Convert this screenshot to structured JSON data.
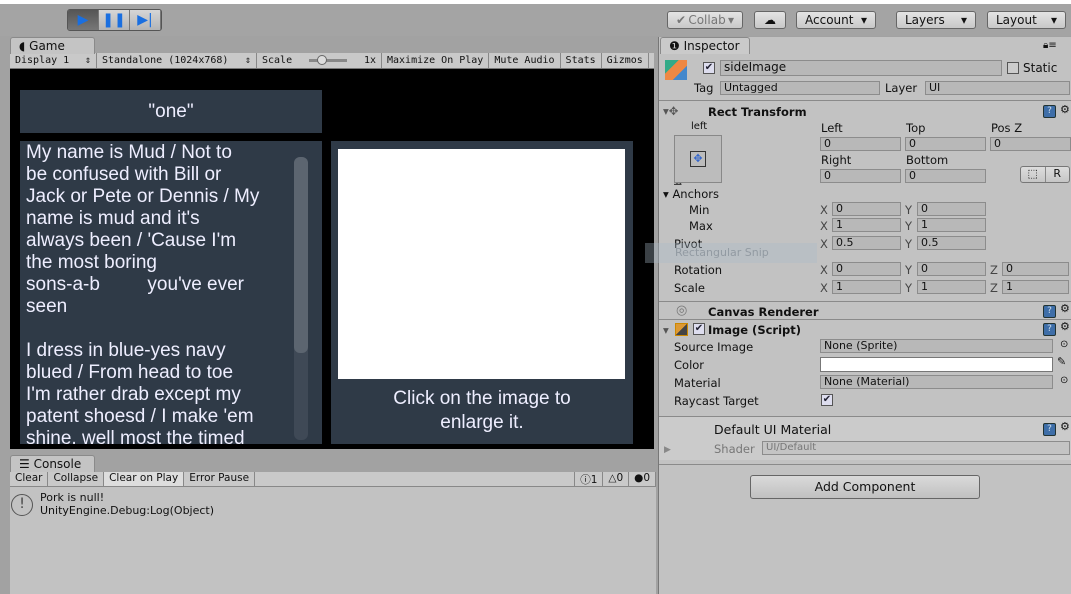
{
  "toolbar": {
    "play_icon": "play-icon",
    "pause_icon": "pause-icon",
    "step_icon": "step-icon",
    "collab": "Collab",
    "account": "Account",
    "layers": "Layers",
    "layout": "Layout"
  },
  "game": {
    "tab": "Game",
    "display": "Display 1",
    "resolution": "Standalone (1024x768)",
    "scale_label": "Scale",
    "scale_value": "1x",
    "maximize": "Maximize On Play",
    "mute": "Mute Audio",
    "stats": "Stats",
    "gizmos": "Gizmos",
    "header": "\"one\"",
    "poem_lines": [
      "My name is Mud / Not to",
      "be confused with Bill or",
      "Jack or Pete or Dennis / My",
      "name is mud and it's",
      "always been / 'Cause I'm",
      "the most boring",
      "sons-a-b         you've ever",
      "seen",
      "",
      "I dress in blue-yes navy",
      "blued / From head to toe",
      "I'm rather drab except my",
      "patent shoesd / I make 'em",
      "shine, well most the timed"
    ],
    "caption": "Click on the image to enlarge it.",
    "image_color": "#ffffff",
    "panel_color": "#2f3a47"
  },
  "console": {
    "tab": "Console",
    "clear": "Clear",
    "collapse": "Collapse",
    "clear_on_play": "Clear on Play",
    "error_pause": "Error Pause",
    "info_count": "1",
    "warn_count": "0",
    "error_count": "0",
    "message_line1": "Pork is null!",
    "message_line2": "UnityEngine.Debug:Log(Object)"
  },
  "inspector": {
    "tab": "Inspector",
    "object_name": "sideImage",
    "static": "Static",
    "tag_label": "Tag",
    "tag": "Untagged",
    "layer_label": "Layer",
    "layer": "UI",
    "rect_transform": "Rect Transform",
    "anchor_preset_top": "left",
    "anchor_preset_side": "bottom",
    "left_label": "Left",
    "left": "0",
    "top_label": "Top",
    "top": "0",
    "posz_label": "Pos Z",
    "posz": "0",
    "right_label": "Right",
    "right": "0",
    "bottom_label": "Bottom",
    "bottom": "0",
    "r_button": "R",
    "anchors": "Anchors",
    "min": "Min",
    "max": "Max",
    "pivot": "Pivot",
    "rotation": "Rotation",
    "scale": "Scale",
    "x": "X",
    "y": "Y",
    "z": "Z",
    "min_x": "0",
    "min_y": "0",
    "max_x": "1",
    "max_y": "1",
    "pivot_x": "0.5",
    "pivot_y": "0.5",
    "rot_x": "0",
    "rot_y": "0",
    "rot_z": "0",
    "scale_x": "1",
    "scale_y": "1",
    "scale_z": "1",
    "snip_tooltip": "Rectangular Snip",
    "canvas_renderer": "Canvas Renderer",
    "image_script": "Image (Script)",
    "source_image_label": "Source Image",
    "source_image": "None (Sprite)",
    "color_label": "Color",
    "color_value": "#ffffff",
    "material_label": "Material",
    "material": "None (Material)",
    "raycast_label": "Raycast Target",
    "default_material": "Default UI Material",
    "shader_label": "Shader",
    "shader": "UI/Default",
    "add_component": "Add Component"
  }
}
